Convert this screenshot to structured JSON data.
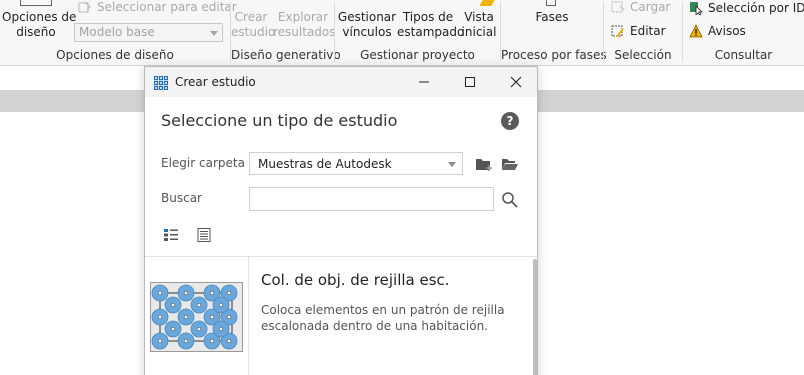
{
  "ribbon": {
    "design_options": {
      "button": {
        "line1": "Opciones de",
        "line2": "diseño"
      },
      "select_for_edit": "Seleccionar para editar",
      "combo_value": "Modelo base",
      "panel_title": "Opciones de diseño"
    },
    "generative": {
      "create": {
        "line1": "Crear",
        "line2": "estudio"
      },
      "explore": {
        "line1": "Explorar",
        "line2": "resultados"
      },
      "panel_title": "Diseño generativo"
    },
    "project": {
      "manage_links": {
        "line1": "Gestionar",
        "line2": "vínculos"
      },
      "titleblocks": {
        "line1": "Tipos de",
        "line2": "estampado"
      },
      "starting_view": {
        "line1": "Vista",
        "line2": "inicial"
      },
      "panel_title": "Gestionar proyecto"
    },
    "phasing": {
      "phases": "Fases",
      "panel_title": "Proceso por fases"
    },
    "selection": {
      "load": "Cargar",
      "edit": "Editar",
      "panel_title": "Selección"
    },
    "inquiry": {
      "select_by_id": "Selección por ID",
      "warnings": "Avisos",
      "panel_title": "Consultar"
    }
  },
  "dialog": {
    "title": "Crear estudio",
    "heading": "Seleccione un tipo de estudio",
    "help": "?",
    "folder_label": "Elegir carpeta",
    "folder_value": "Muestras de Autodesk",
    "search_label": "Buscar",
    "search_value": "",
    "study": {
      "title": "Col. de obj. de rejilla esc.",
      "description": "Coloca elementos en un patrón de rejilla escalonada dentro de una habitación."
    }
  },
  "colors": {
    "accent": "#0696d7",
    "dot_fill": "#6aa7db",
    "warning": "#f0b400"
  },
  "icons": [
    "grid-app-icon",
    "minimize-icon",
    "maximize-icon",
    "close-icon",
    "help-icon",
    "new-folder-icon",
    "open-folder-icon",
    "search-icon",
    "list-view-icon",
    "detail-view-icon",
    "warnings-icon",
    "select-by-id-icon",
    "edit-selection-icon",
    "load-selection-icon"
  ]
}
